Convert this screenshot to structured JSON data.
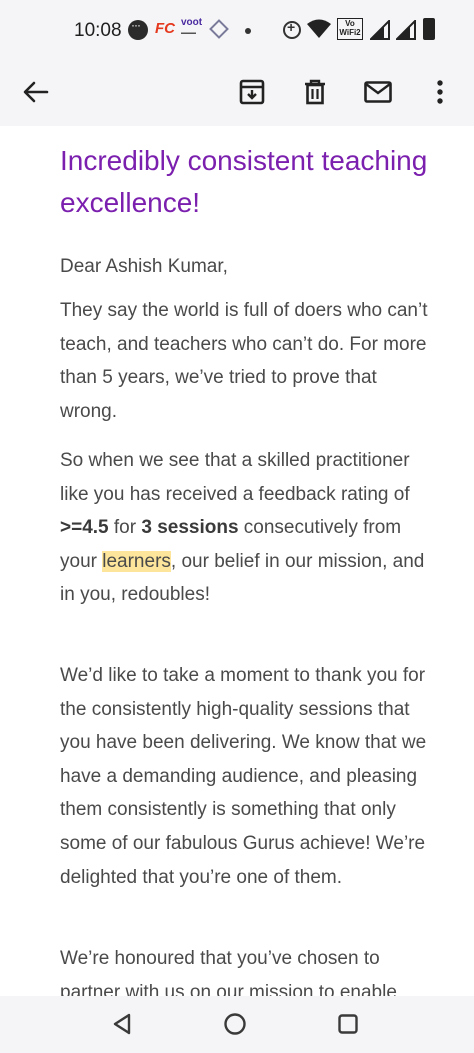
{
  "status_bar": {
    "time": "10:08",
    "fc_label": "FC",
    "voot_label": "voot",
    "vo_wifi_top": "Vo",
    "vo_wifi_bottom": "WiFi2",
    "icons": [
      "chat-bubble-icon",
      "fc-app-icon",
      "voot-app-icon",
      "diamond-app-icon",
      "dot-icon",
      "data-saver-icon",
      "wifi-icon",
      "vowifi-icon",
      "signal-icon",
      "signal-icon",
      "battery-icon"
    ]
  },
  "toolbar": {
    "icons": [
      "back-arrow-icon",
      "archive-icon",
      "delete-icon",
      "mail-icon",
      "more-vert-icon"
    ]
  },
  "email": {
    "headline": "Incredibly consistent teaching excellence!",
    "greeting": "Dear Ashish Kumar,",
    "p1": "They say the world is full of doers who can’t teach, and teachers who can’t do. For more than 5 years, we’ve tried to prove that wrong.",
    "p2": {
      "part1": "So when we see that a skilled practitioner like you has received a feedback rating of ",
      "rating": ">=4.5",
      "part2": " for ",
      "sessions": "3 sessions",
      "part3": " consecutively from your ",
      "highlight": "learners",
      "part4": ", our belief in our mission, and in you, redoubles!"
    },
    "p3": "We’d like to take a moment to thank you for the consistently high-quality sessions that you have been delivering. We know that we have a demanding audience, and pleasing them consistently is something that only some of our fabulous Gurus achieve! We’re delighted that you’re one of them.",
    "p4": "We’re honoured that you’ve chosen to partner with us on our mission to enable"
  },
  "nav_bar": {
    "icons": [
      "back-triangle-icon",
      "home-circle-icon",
      "recents-square-icon"
    ]
  },
  "colors": {
    "headline": "#7b1fae",
    "body_text": "#4a4a4a",
    "highlight": "#fde69b",
    "chrome_bg": "#f5f5f7"
  }
}
